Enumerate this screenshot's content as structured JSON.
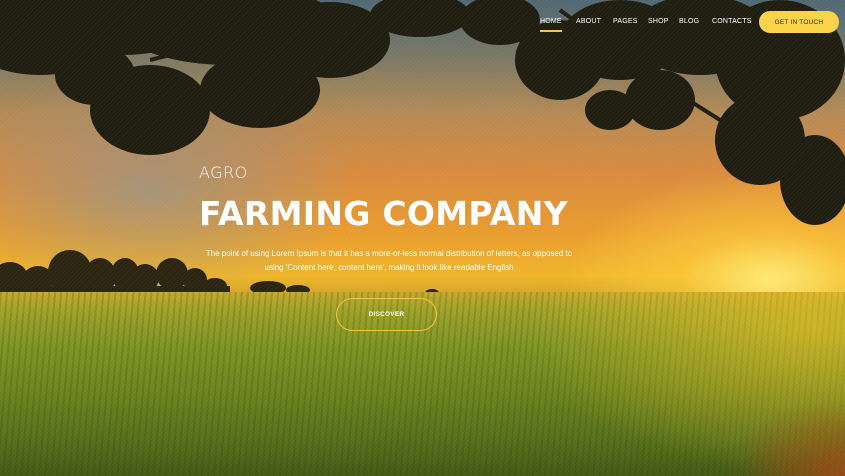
{
  "nav": {
    "items": [
      {
        "label": "HOME",
        "active": true
      },
      {
        "label": "ABOUT",
        "active": false
      },
      {
        "label": "PAGES",
        "active": false
      },
      {
        "label": "SHOP",
        "active": false
      },
      {
        "label": "BLOG",
        "active": false
      },
      {
        "label": "CONTACTS",
        "active": false
      }
    ],
    "cta_label": "GET IN TOUCH"
  },
  "hero": {
    "kicker": "AGRO",
    "title": "FARMING COMPANY",
    "description": "The point of using Lorem Ipsum is that it has a more-or-less normal distribution of letters, as opposed to using 'Content here, content here', making it look like readable English",
    "button_label": "DISCOVER"
  },
  "colors": {
    "accent": "#fad34a",
    "text": "#ffffff"
  }
}
